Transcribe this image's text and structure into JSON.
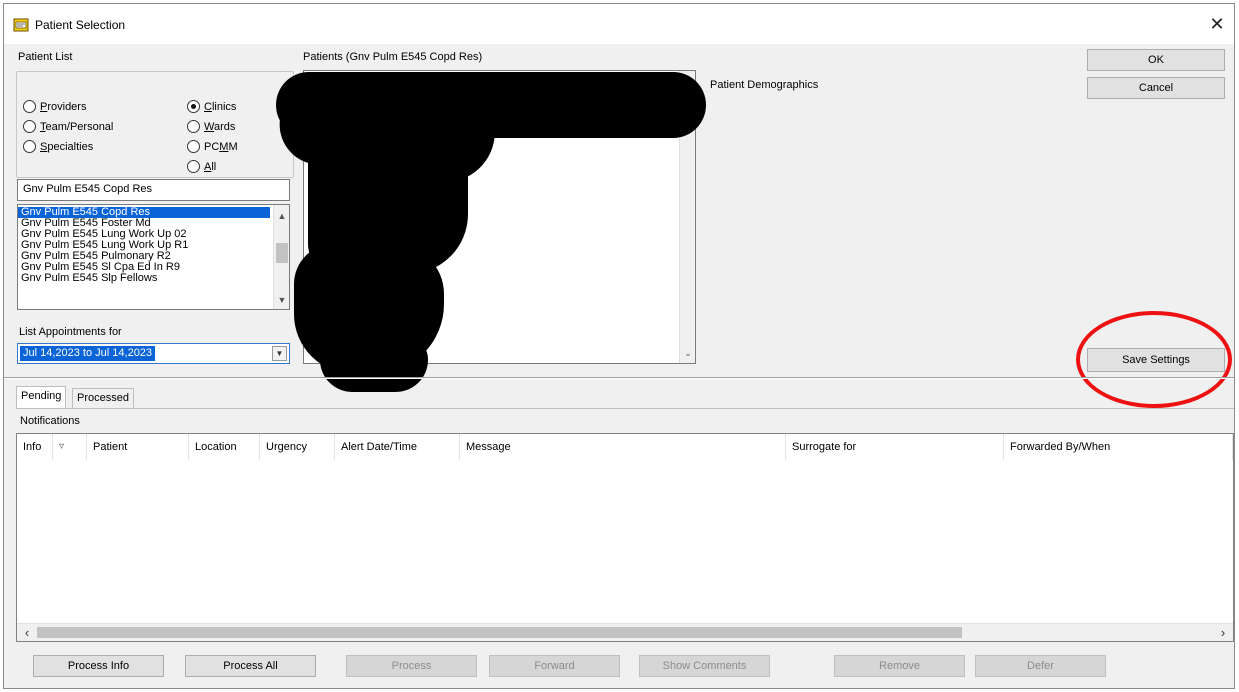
{
  "window": {
    "title": "Patient Selection",
    "close_glyph": "✕"
  },
  "patient_list": {
    "label": "Patient List",
    "radios_left": [
      {
        "pre": "",
        "key": "P",
        "post": "roviders",
        "selected": false
      },
      {
        "pre": "",
        "key": "T",
        "post": "eam/Personal",
        "selected": false
      },
      {
        "pre": "",
        "key": "S",
        "post": "pecialties",
        "selected": false
      }
    ],
    "radios_right": [
      {
        "pre": "",
        "key": "C",
        "post": "linics",
        "selected": true
      },
      {
        "pre": "",
        "key": "W",
        "post": "ards",
        "selected": false
      },
      {
        "pre": "PC",
        "key": "M",
        "post": "M",
        "selected": false
      },
      {
        "pre": "",
        "key": "A",
        "post": "ll",
        "selected": false
      }
    ],
    "search_value": "Gnv Pulm E545 Copd Res",
    "items": [
      "Gnv Pulm E545 Copd Res",
      "Gnv Pulm E545 Foster Md",
      "Gnv Pulm E545 Lung Work Up 02",
      "Gnv Pulm E545 Lung Work Up R1",
      "Gnv Pulm E545 Pulmonary R2",
      "Gnv Pulm E545 Sl Cpa Ed In R9",
      "Gnv Pulm E545 Slp Fellows"
    ],
    "selected_index": 0
  },
  "appointments": {
    "label": "List Appointments for",
    "value": "Jul 14,2023 to Jul 14,2023"
  },
  "patients": {
    "label": "Patients (Gnv Pulm E545 Copd Res)"
  },
  "demographics": {
    "label": "Patient Demographics"
  },
  "buttons": {
    "ok": "OK",
    "cancel": "Cancel",
    "save_settings": "Save Settings"
  },
  "tabs": [
    {
      "label": "Pending",
      "active": true
    },
    {
      "label": "Processed",
      "active": false
    }
  ],
  "notifications": {
    "label": "Notifications",
    "columns": [
      "Info",
      "▿",
      "Patient",
      "Location",
      "Urgency",
      "Alert Date/Time",
      "Message",
      "Surrogate for",
      "Forwarded By/When"
    ]
  },
  "bottom_buttons": [
    {
      "label": "Process Info",
      "enabled": true
    },
    {
      "label": "Process All",
      "enabled": true
    },
    {
      "label": "Process",
      "enabled": false
    },
    {
      "label": "Forward",
      "enabled": false
    },
    {
      "label": "Show Comments",
      "enabled": false
    },
    {
      "label": "Remove",
      "enabled": false
    },
    {
      "label": "Defer",
      "enabled": false
    }
  ],
  "colors": {
    "selection": "#0a64d8",
    "annotation": "#ee1111",
    "redaction": "#000000"
  }
}
